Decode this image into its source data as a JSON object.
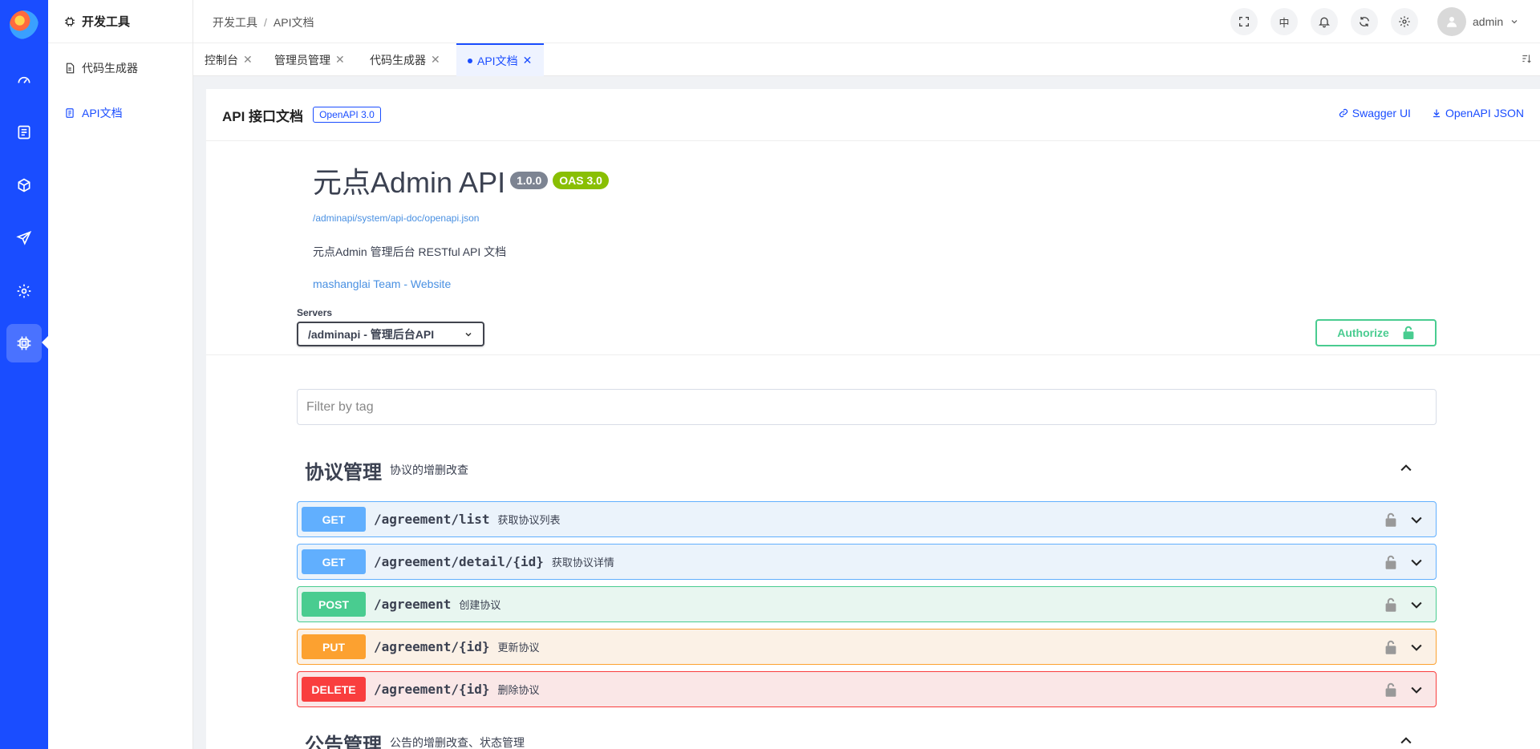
{
  "sidebar": {
    "section_title": "开发工具",
    "items": [
      {
        "label": "代码生成器"
      },
      {
        "label": "API文档"
      }
    ]
  },
  "header": {
    "breadcrumb": [
      "开发工具",
      "API文档"
    ],
    "lang_label": "中",
    "user_name": "admin"
  },
  "tabs": [
    {
      "label": "控制台"
    },
    {
      "label": "管理员管理"
    },
    {
      "label": "代码生成器"
    },
    {
      "label": "API文档",
      "active": true
    }
  ],
  "page": {
    "title": "API 接口文档",
    "badge": "OpenAPI 3.0",
    "link_swagger": "Swagger UI",
    "link_json": "OpenAPI JSON"
  },
  "swagger": {
    "title": "元点Admin API",
    "version": "1.0.0",
    "oas": "OAS 3.0",
    "spec_url": "/adminapi/system/api-doc/openapi.json",
    "description": "元点Admin 管理后台 RESTful API 文档",
    "contact": "mashanglai Team - Website",
    "servers_label": "Servers",
    "server_selected": "/adminapi - 管理后台API",
    "authorize_label": "Authorize",
    "filter_placeholder": "Filter by tag",
    "tags": [
      {
        "name": "协议管理",
        "description": "协议的增删改查",
        "operations": [
          {
            "method": "GET",
            "path": "/agreement/list",
            "summary": "获取协议列表"
          },
          {
            "method": "GET",
            "path": "/agreement/detail/{id}",
            "summary": "获取协议详情"
          },
          {
            "method": "POST",
            "path": "/agreement",
            "summary": "创建协议"
          },
          {
            "method": "PUT",
            "path": "/agreement/{id}",
            "summary": "更新协议"
          },
          {
            "method": "DELETE",
            "path": "/agreement/{id}",
            "summary": "删除协议"
          }
        ]
      },
      {
        "name": "公告管理",
        "description": "公告的增删改查、状态管理",
        "operations": []
      }
    ]
  },
  "colors": {
    "brand": "#1a4dff",
    "get": "#61affe",
    "post": "#49cc90",
    "put": "#fca130",
    "delete": "#f93e3e"
  }
}
